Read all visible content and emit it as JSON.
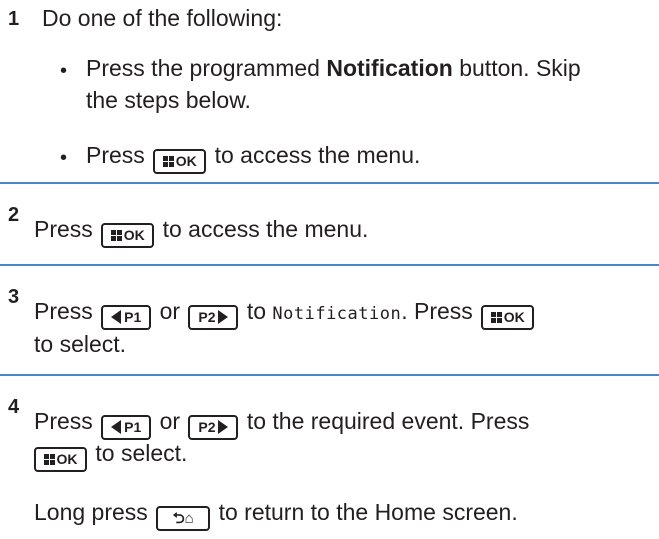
{
  "steps": [
    {
      "number": "1",
      "intro": "Do one of the following:",
      "bullets": [
        {
          "line1_pre": "Press the programmed ",
          "line1_bold": "Notification",
          "line1_post": " button. Skip",
          "line2": "the steps below."
        },
        {
          "pre": "Press",
          "post": "to access the menu."
        }
      ]
    },
    {
      "number": "2",
      "pre": "Press",
      "post": "to access the menu."
    },
    {
      "number": "3",
      "pre": "Press",
      "or": "or",
      "to": "to",
      "menu_item": "Notification",
      "post": ". Press",
      "line2": "to select."
    },
    {
      "number": "4",
      "pre": "Press",
      "or": "or",
      "post": "to the required event. Press",
      "line2": "to select."
    }
  ],
  "footer": {
    "pre": "Long press",
    "post": "to return to the Home screen."
  },
  "keys": {
    "ok": "OK",
    "p1": "P1",
    "p2": "P2",
    "back_glyph": "⮌⌂"
  },
  "bullet_char": "•",
  "colors": {
    "divider": "#4a86c8",
    "text": "#231f20"
  }
}
